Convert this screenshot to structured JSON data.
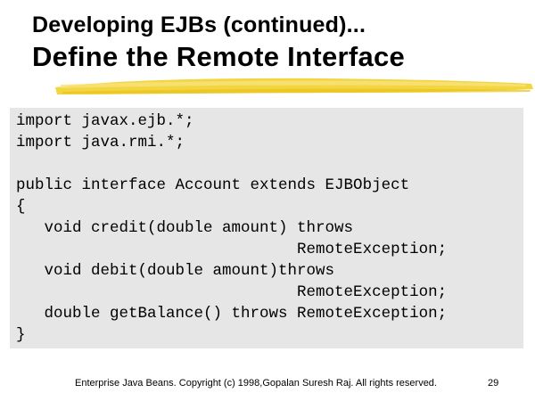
{
  "slide": {
    "title_line1": "Developing EJBs (continued)...",
    "title_line2": "Define the Remote Interface",
    "accent_color": "#f2d02e",
    "code_background": "#e6e6e6"
  },
  "code": {
    "lines": [
      "import javax.ejb.*;",
      "import java.rmi.*;",
      "",
      "public interface Account extends EJBObject",
      "{",
      "   void credit(double amount) throws",
      "                              RemoteException;",
      "   void debit(double amount)throws",
      "                              RemoteException;",
      "   double getBalance() throws RemoteException;",
      "}"
    ]
  },
  "footer": {
    "copyright": "Enterprise Java Beans. Copyright (c) 1998,Gopalan Suresh Raj. All rights reserved.",
    "page_number": "29"
  }
}
